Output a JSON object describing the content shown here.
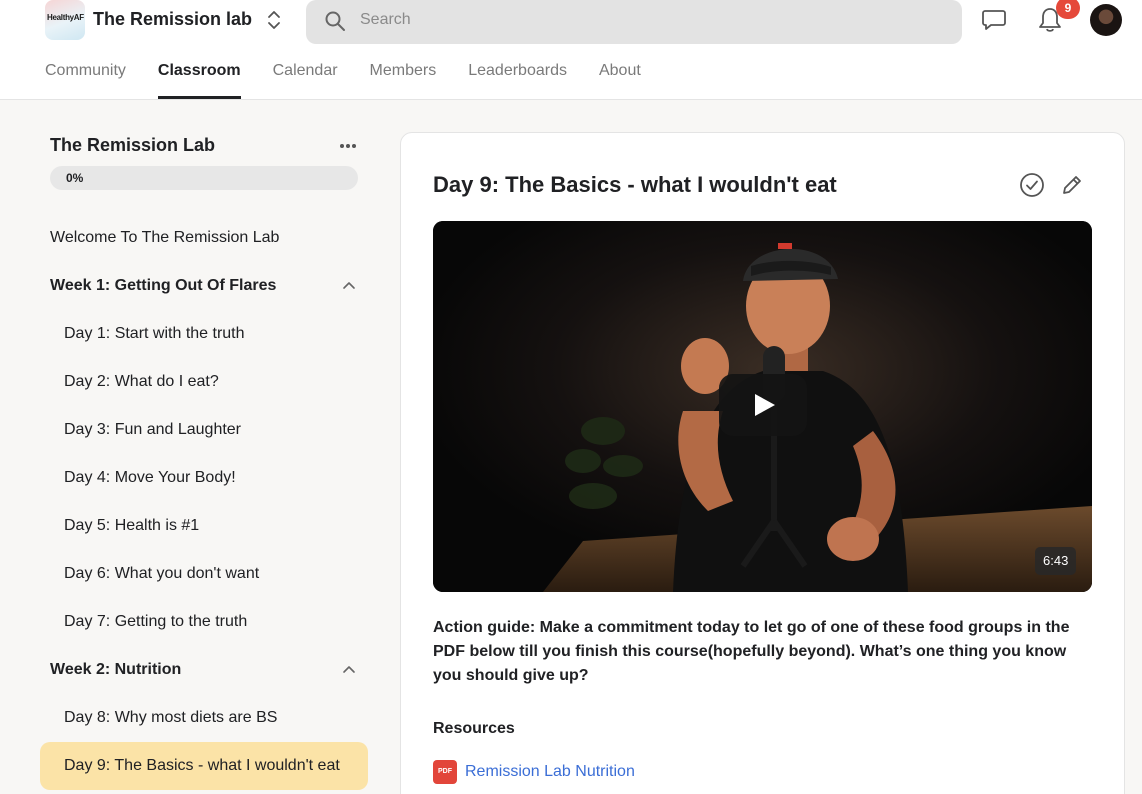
{
  "header": {
    "logo_text": "HealthyAF",
    "app_title": "The Remission lab",
    "search_placeholder": "Search",
    "notification_count": "9"
  },
  "nav": {
    "tabs": [
      {
        "label": "Community",
        "active": false
      },
      {
        "label": "Classroom",
        "active": true
      },
      {
        "label": "Calendar",
        "active": false
      },
      {
        "label": "Members",
        "active": false
      },
      {
        "label": "Leaderboards",
        "active": false
      },
      {
        "label": "About",
        "active": false
      }
    ]
  },
  "sidebar": {
    "course_title": "The Remission Lab",
    "progress_label": "0%",
    "progress_fraction": 0,
    "items": [
      {
        "label": "Welcome To The Remission Lab",
        "kind": "top"
      },
      {
        "label": "Week 1: Getting Out Of Flares",
        "kind": "week",
        "expanded": true
      },
      {
        "label": "Day 1: Start with the truth",
        "kind": "sub"
      },
      {
        "label": "Day 2: What do I eat?",
        "kind": "sub"
      },
      {
        "label": "Day 3: Fun and Laughter",
        "kind": "sub"
      },
      {
        "label": "Day 4: Move Your Body!",
        "kind": "sub"
      },
      {
        "label": "Day 5: Health is #1",
        "kind": "sub"
      },
      {
        "label": "Day 6: What you don't want",
        "kind": "sub"
      },
      {
        "label": "Day 7: Getting to the truth",
        "kind": "sub"
      },
      {
        "label": "Week 2: Nutrition",
        "kind": "week",
        "expanded": true
      },
      {
        "label": "Day 8: Why most diets are BS",
        "kind": "sub"
      },
      {
        "label": "Day 9: The Basics - what I wouldn't eat",
        "kind": "sub",
        "active": true
      }
    ]
  },
  "lesson": {
    "title": "Day 9: The Basics - what I wouldn't eat",
    "video_duration": "6:43",
    "action_guide": "Action guide: Make a commitment today to let go of one of these food groups in the PDF below till you finish this course(hopefully beyond).  What’s one thing you know you should give up?",
    "resources_heading": "Resources",
    "resources": [
      {
        "type_label": "PDF",
        "title": "Remission Lab Nutrition"
      }
    ]
  },
  "colors": {
    "accent_active_lesson": "#fbe3a7",
    "badge": "#e5493a",
    "link": "#3b6ed6",
    "pdf": "#e2453a"
  }
}
